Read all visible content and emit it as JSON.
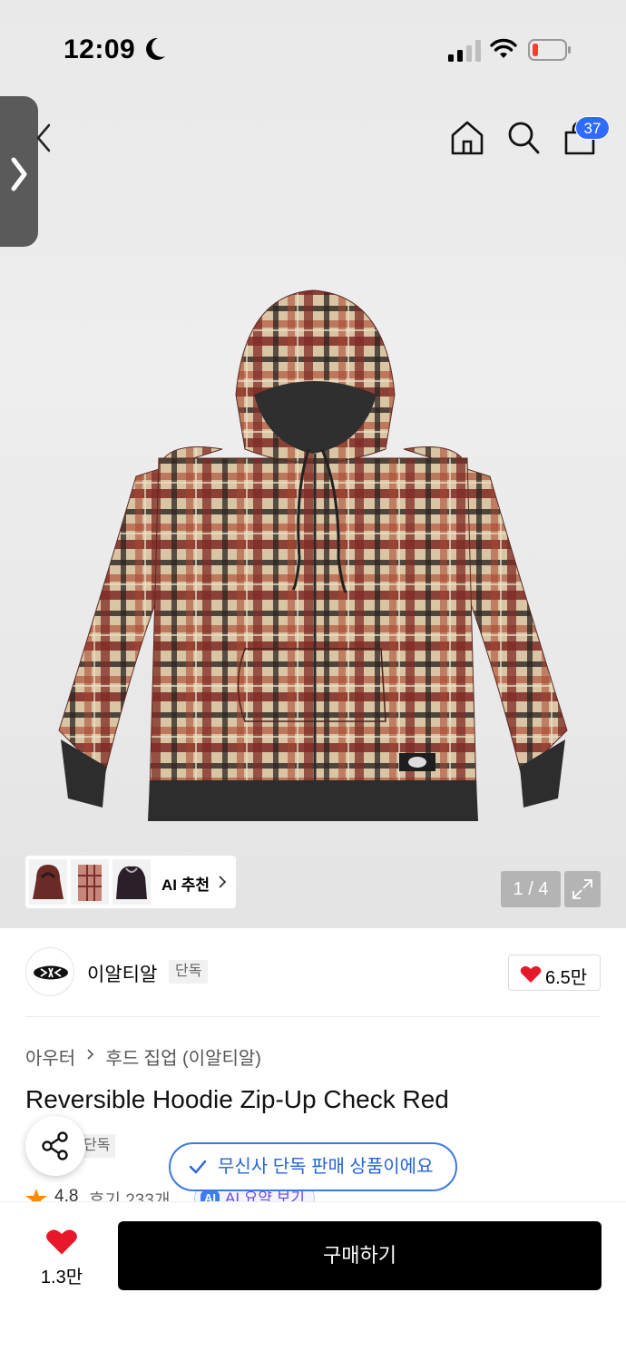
{
  "status_bar": {
    "time": "12:09"
  },
  "header": {
    "cart_count": "37"
  },
  "gallery": {
    "ai_label": "AI 추천",
    "page_indicator": "1 / 4"
  },
  "brand": {
    "name": "이알티알",
    "tag": "단독",
    "likes": "6.5만"
  },
  "breadcrumb": [
    "아우터",
    "후드 집업 (이알티알)"
  ],
  "product": {
    "title": "Reversible Hoodie Zip-Up Check Red",
    "exclusive_tag": "단독",
    "rating": "4.8",
    "reviews": "후기 233개",
    "ai_summary": "AI 요약 보기",
    "ai_badge": "AI"
  },
  "toast": {
    "text": "무신사 단독 판매 상품이에요"
  },
  "bottom": {
    "wish_count": "1.3만",
    "buy_label": "구매하기"
  },
  "colors": {
    "accent_blue": "#2f6bff",
    "heart_red": "#e8182a",
    "star": "#ff8a00"
  }
}
